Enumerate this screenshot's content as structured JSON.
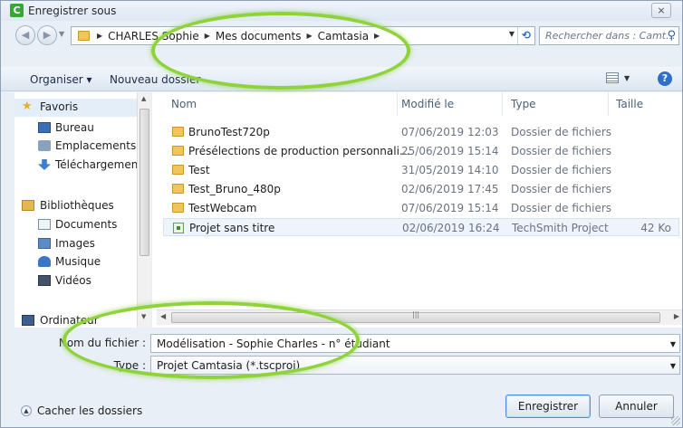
{
  "window": {
    "title": "Enregistrer sous",
    "app_icon_letter": "C",
    "close_glyph": "⨯"
  },
  "address": {
    "crumbs": [
      "CHARLES Sophie",
      "Mes documents",
      "Camtasia"
    ],
    "search_placeholder": "Rechercher dans : Camt..."
  },
  "toolbar": {
    "organiser": "Organiser ▾",
    "new_folder": "Nouveau dossier"
  },
  "sidebar": {
    "favorites": "Favoris",
    "desktop": "Bureau",
    "recent_places": "Emplacements réc",
    "downloads": "Téléchargements",
    "libraries": "Bibliothèques",
    "documents": "Documents",
    "images": "Images",
    "music": "Musique",
    "videos": "Vidéos",
    "computer": "Ordinateur"
  },
  "files": {
    "columns": {
      "name": "Nom",
      "modified": "Modifié le",
      "type": "Type",
      "size": "Taille"
    },
    "rows": [
      {
        "name": "BrunoTest720p",
        "modified": "07/06/2019 12:03",
        "type": "Dossier de fichiers",
        "size": ""
      },
      {
        "name": "Présélections de production personnalisé...",
        "modified": "25/06/2019 15:14",
        "type": "Dossier de fichiers",
        "size": ""
      },
      {
        "name": "Test",
        "modified": "31/05/2019 14:10",
        "type": "Dossier de fichiers",
        "size": ""
      },
      {
        "name": "Test_Bruno_480p",
        "modified": "02/06/2019 17:45",
        "type": "Dossier de fichiers",
        "size": ""
      },
      {
        "name": "TestWebcam",
        "modified": "07/06/2019 15:14",
        "type": "Dossier de fichiers",
        "size": ""
      },
      {
        "name": "Projet sans titre",
        "modified": "02/06/2019 16:24",
        "type": "TechSmith Project",
        "size": "42 Ko"
      }
    ]
  },
  "form": {
    "filename_label": "Nom du fichier :",
    "filename_value": "Modélisation - Sophie Charles - n° étudiant",
    "type_label": "Type :",
    "type_value": "Projet Camtasia (*.tscproj)"
  },
  "footer": {
    "hide_folders": "Cacher les dossiers",
    "save": "Enregistrer",
    "cancel": "Annuler"
  },
  "colors": {
    "annotation": "#8fd33a",
    "accent": "#2f6fc8"
  }
}
